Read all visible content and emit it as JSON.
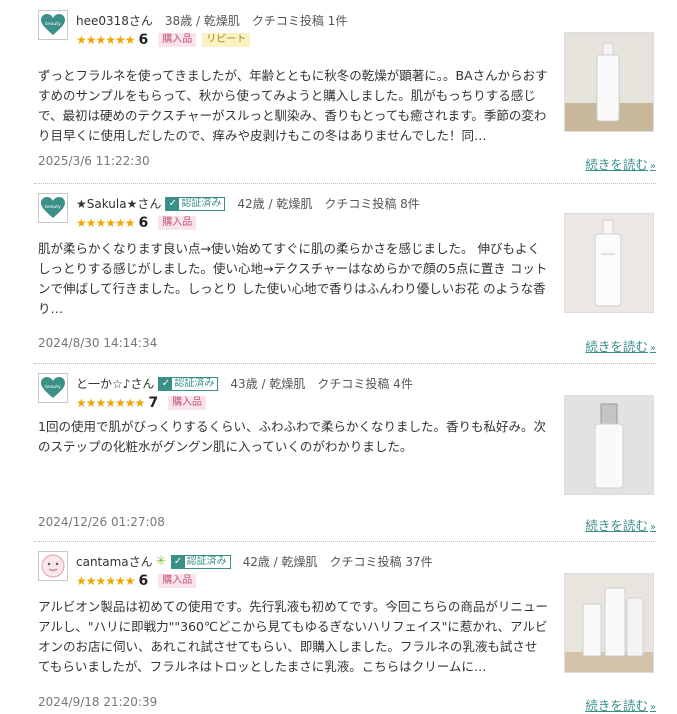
{
  "reviews": [
    {
      "name": "hee0318さん",
      "meta": "38歳 / 乾燥肌　クチコミ投稿 1件",
      "verified": false,
      "stars": "★★★★★★",
      "score": "6",
      "tags": [
        "購入品",
        "リピート"
      ],
      "text": "ずっとフラルネを使ってきましたが、年齢とともに秋冬の乾燥が顕著に。。BAさんからおすすめのサンプルをもらって、秋から使ってみようと購入しました。肌がもっちりする感じで、最初は硬めのテクスチャーがスルっと馴染み、香りもとっても癒されます。季節の変わり目早くに使用しだしたので、痒みや皮剥けもこの冬はありませんでした！同…",
      "date": "2025/3/6 11:22:30",
      "more": "続きを読む",
      "avatar_icon": "heart-logo-icon"
    },
    {
      "name": "★Sakula★さん",
      "meta": "42歳 / 乾燥肌　クチコミ投稿 8件",
      "verified": true,
      "verified_label": "認証済み",
      "stars": "★★★★★★",
      "score": "6",
      "tags": [
        "購入品"
      ],
      "text": "肌が柔らかくなります良い点→使い始めてすぐに肌の柔らかさを感じました。 伸びもよくしっとりする感じがしました。使い心地→テクスチャーはなめらかで顔の5点に置き コットンで伸ばして行きました。しっとり した使い心地で香りはふんわり優しいお花 のような香り…",
      "date": "2024/8/30 14:14:34",
      "more": "続きを読む",
      "avatar_icon": "heart-logo-icon"
    },
    {
      "name": "と一か☆♪さん",
      "meta": "43歳 / 乾燥肌　クチコミ投稿 4件",
      "verified": true,
      "verified_label": "認証済み",
      "stars": "★★★★★★★",
      "score": "7",
      "tags": [
        "購入品"
      ],
      "text": "1回の使用で肌がびっくりするくらい、ふわふわで柔らかくなりました。香りも私好み。次のステップの化粧水がグングン肌に入っていくのがわかりました。",
      "date": "2024/12/26 01:27:08",
      "more": "続きを読む",
      "avatar_icon": "heart-logo-icon"
    },
    {
      "name": "cantamaさん",
      "meta": "42歳 / 乾燥肌　クチコミ投稿 37件",
      "verified": true,
      "verified_label": "認証済み",
      "stars": "★★★★★★",
      "score": "6",
      "tags": [
        "購入品"
      ],
      "text": "アルビオン製品は初めての使用です。先行乳液も初めてです。今回こちらの商品がリニューアルし、\"ハリに即戦力\"\"360℃どこから見てもゆるぎないハリフェイス\"に惹かれ、アルビオンのお店に伺い、あれこれ試させてもらい、即購入しました。フラルネの乳液も試させてもらいましたが、フラルネはトロッとしたまさに乳液。こちらはクリームに…",
      "date": "2024/9/18 21:20:39",
      "more": "続きを読む",
      "avatar_icon": "face-avatar-icon"
    }
  ],
  "colors": {
    "accent": "#3a8f87",
    "star": "#f0a500",
    "purchased_bg": "#fbe3ea",
    "repeat_bg": "#fbf2c4"
  }
}
